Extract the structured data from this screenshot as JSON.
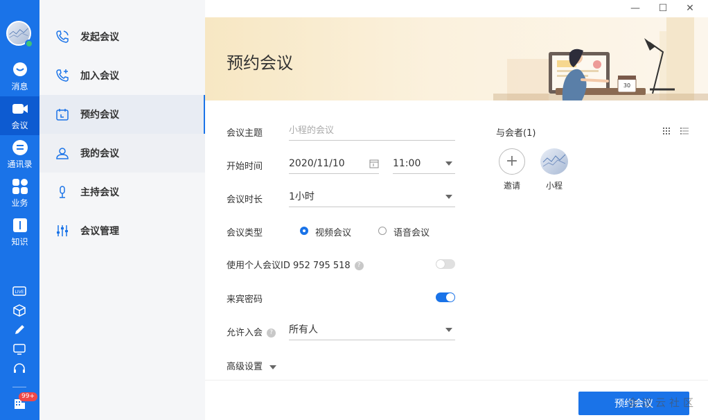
{
  "rail": {
    "items": [
      {
        "label": "消息",
        "icon": "message-icon"
      },
      {
        "label": "会议",
        "icon": "meeting-icon"
      },
      {
        "label": "通讯录",
        "icon": "contacts-icon"
      },
      {
        "label": "业务",
        "icon": "apps-icon"
      },
      {
        "label": "知识",
        "icon": "knowledge-icon"
      }
    ],
    "live_label": "LIVE",
    "badge": "99+"
  },
  "subnav": {
    "items": [
      {
        "label": "发起会议"
      },
      {
        "label": "加入会议"
      },
      {
        "label": "预约会议"
      },
      {
        "label": "我的会议"
      },
      {
        "label": "主持会议"
      },
      {
        "label": "会议管理"
      }
    ]
  },
  "window": {
    "minimize": "—",
    "maximize": "☐",
    "close": "✕"
  },
  "banner": {
    "title": "预约会议",
    "calendar_day": "30"
  },
  "form": {
    "subject_label": "会议主题",
    "subject_placeholder": "小程的会议",
    "start_label": "开始时间",
    "start_date": "2020/11/10",
    "start_time": "11:00",
    "duration_label": "会议时长",
    "duration_value": "1小时",
    "type_label": "会议类型",
    "type_video": "视频会议",
    "type_audio": "语音会议",
    "personal_id_label": "使用个人会议ID 952 795 518",
    "password_label": "来宾密码",
    "allow_label": "允许入会",
    "allow_value": "所有人",
    "advanced_label": "高级设置"
  },
  "participants": {
    "title": "与会者(1)",
    "invite_label": "邀请",
    "member_name": "小程"
  },
  "footer": {
    "submit_label": "预约会议",
    "watermark": "会议云社区"
  },
  "colors": {
    "accent": "#1a73e8",
    "rail": "#1a73e8",
    "banner": "#f7e7c3"
  }
}
